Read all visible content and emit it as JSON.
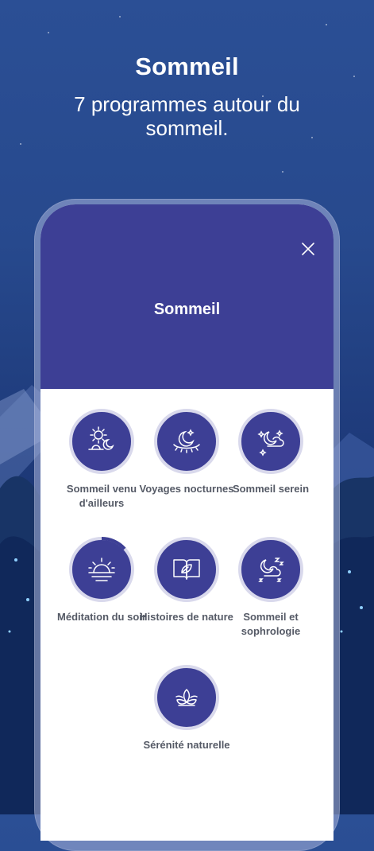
{
  "hero": {
    "title": "Sommeil",
    "subtitle": "7 programmes autour du sommeil."
  },
  "screen": {
    "title": "Sommeil",
    "close_icon": "close-icon"
  },
  "colors": {
    "background": "#27498d",
    "header": "#3d3f95",
    "circle": "#3d3f95",
    "ring": "#d9d9ec",
    "label": "#555a66"
  },
  "programs": [
    {
      "label": "Sommeil venu d'ailleurs",
      "icon": "sun-moon-icon"
    },
    {
      "label": "Voyages nocturnes",
      "icon": "moon-eye-icon"
    },
    {
      "label": "Sommeil serein",
      "icon": "moon-cloud-stars-icon"
    },
    {
      "label": "Méditation du soir",
      "icon": "sunset-icon"
    },
    {
      "label": "Histoires de nature",
      "icon": "open-book-leaf-icon"
    },
    {
      "label": "Sommeil et sophrologie",
      "icon": "moon-cloud-zzz-icon"
    },
    {
      "label": "Sérénité naturelle",
      "icon": "lotus-icon"
    }
  ]
}
